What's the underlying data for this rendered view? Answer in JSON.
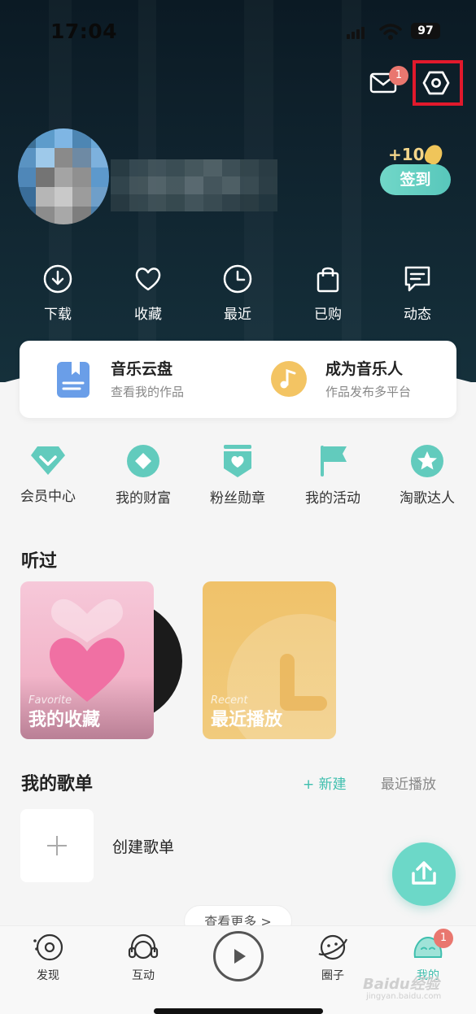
{
  "status_bar": {
    "time": "17:04",
    "battery": "97"
  },
  "header": {
    "mail_badge": "1",
    "coins": "+10",
    "checkin_label": "签到"
  },
  "shortcuts": [
    {
      "label": "下载",
      "icon": "download-icon"
    },
    {
      "label": "收藏",
      "icon": "heart-icon"
    },
    {
      "label": "最近",
      "icon": "clock-icon"
    },
    {
      "label": "已购",
      "icon": "shopping-bag-icon"
    },
    {
      "label": "动态",
      "icon": "message-icon"
    }
  ],
  "cloud_card": {
    "left": {
      "title": "音乐云盘",
      "subtitle": "查看我的作品",
      "icon": "document-icon"
    },
    "right": {
      "title": "成为音乐人",
      "subtitle": "作品发布多平台",
      "icon": "music-note-icon"
    }
  },
  "features": [
    {
      "label": "会员中心",
      "icon": "diamond-icon"
    },
    {
      "label": "我的财富",
      "icon": "wealth-icon"
    },
    {
      "label": "粉丝勋章",
      "icon": "badge-icon"
    },
    {
      "label": "我的活动",
      "icon": "flag-icon"
    },
    {
      "label": "淘歌达人",
      "icon": "star-icon"
    }
  ],
  "heard": {
    "title": "听过",
    "tiles": [
      {
        "small": "Favorite",
        "big": "我的收藏"
      },
      {
        "small": "Recent",
        "big": "最近播放"
      }
    ]
  },
  "playlists": {
    "title": "我的歌单",
    "new_label": "+ 新建",
    "recent_label": "最近播放",
    "create_label": "创建歌单",
    "more_label": "查看更多 >"
  },
  "tabbar": {
    "tabs": [
      {
        "label": "发现"
      },
      {
        "label": "互动"
      },
      {
        "label": "圈子"
      },
      {
        "label": "我的"
      }
    ],
    "badge": "1"
  },
  "watermark": {
    "main": "Baidu经验",
    "sub": "jingyan.baidu.com"
  },
  "colors": {
    "accent": "#3fbfae",
    "badge": "#e9776f",
    "highlight": "#e1192c"
  }
}
